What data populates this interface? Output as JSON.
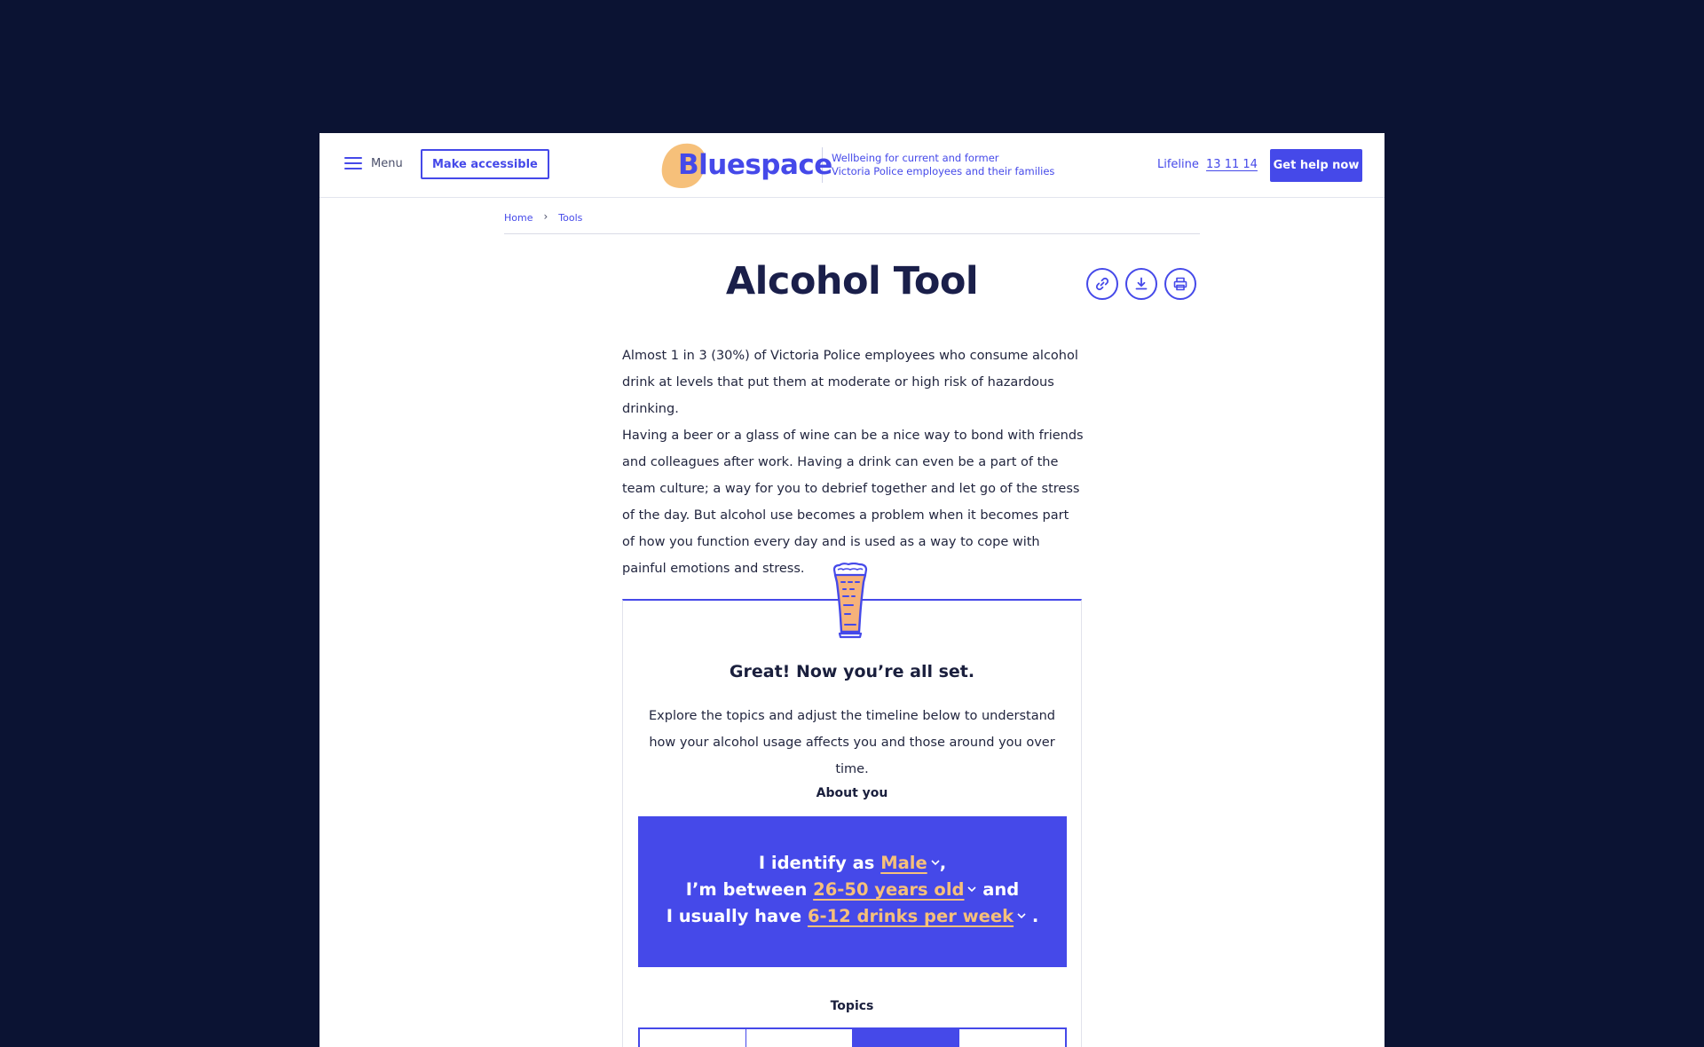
{
  "header": {
    "menu_label": "Menu",
    "accessible_label": "Make accessible",
    "logo_text": "Bluespace",
    "tagline_line1": "Wellbeing for current and former",
    "tagline_line2": "Victoria Police employees and their families",
    "lifeline_label": "Lifeline",
    "lifeline_number": "13 11 14",
    "help_label": "Get help now"
  },
  "breadcrumb": [
    "Home",
    "Tools"
  ],
  "page": {
    "title": "Alcohol Tool",
    "intro_p1": "Almost 1 in 3 (30%) of Victoria Police employees who consume alcohol drink at levels that put them at moderate or high risk of hazardous drinking.",
    "intro_p2": "Having a beer or a glass of wine can be a nice way to bond with friends and colleagues after work. Having a drink can even be a part of the team culture; a way for you to debrief together and let go of the stress of the day. But alcohol use becomes a problem when it becomes part of how you function every day and is used as a way to cope with painful emotions and stress."
  },
  "tool": {
    "heading": "Great! Now you’re all set.",
    "description": "Explore the topics and adjust the timeline below to understand how your alcohol usage affects you and those around you over time.",
    "about_label": "About you",
    "line1_prefix": "I identify as",
    "gender": "Male",
    "line1_suffix": ",",
    "line2_prefix": "I’m between",
    "age": "26-50 years old",
    "line2_suffix": "and",
    "line3_prefix": "I usually have",
    "drinks": "6-12 drinks per week",
    "line3_suffix": ".",
    "topics_label": "Topics",
    "active_tab_index": 2
  },
  "colors": {
    "background": "#0b1333",
    "accent": "#4549e9",
    "highlight": "#f6c07a",
    "logo_blob": "#f6c07a"
  },
  "icons": [
    "hamburger-icon",
    "link-icon",
    "download-icon",
    "print-icon",
    "beer-glass-icon",
    "chevron-down-icon"
  ]
}
